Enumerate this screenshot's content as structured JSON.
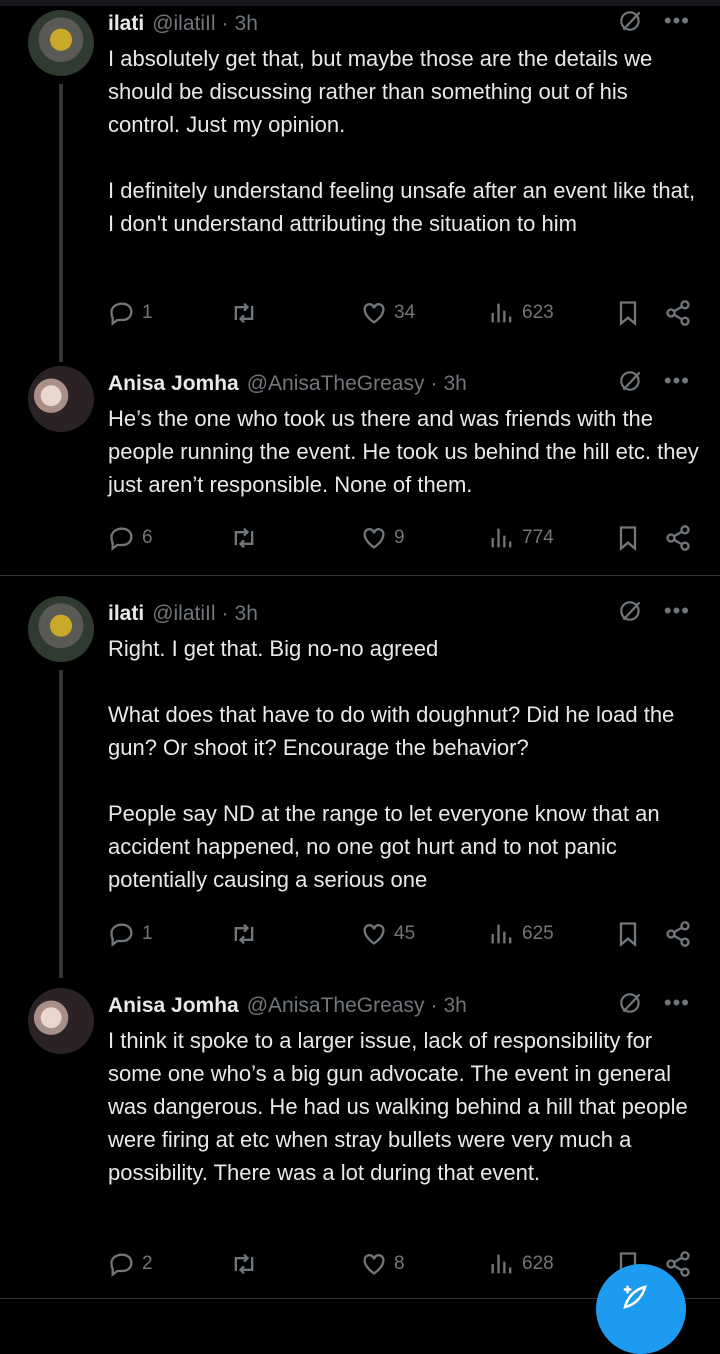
{
  "tweets": [
    {
      "name": "ilati",
      "handle": "@ilatiIl",
      "time": "3h",
      "avatar": "car-avatar",
      "paragraphs": [
        "I absolutely get that, but maybe those are the details we should be discussing rather than something out of his control. Just my opinion.",
        "I definitely understand feeling unsafe after an event like that, I don't understand attributing the situation to him"
      ],
      "replies": "1",
      "retweets": "",
      "likes": "34",
      "views": "623"
    },
    {
      "name": "Anisa Jomha",
      "handle": "@AnisaTheGreasy",
      "time": "3h",
      "avatar": "couple-avatar",
      "paragraphs": [
        "He’s the one who took us there and was friends with the people running the event. He took us behind the hill etc. they just aren’t responsible. None of them."
      ],
      "replies": "6",
      "retweets": "",
      "likes": "9",
      "views": "774"
    },
    {
      "name": "ilati",
      "handle": "@ilatiIl",
      "time": "3h",
      "avatar": "car-avatar",
      "paragraphs": [
        "Right. I get that. Big no-no agreed",
        "What does that have to do with doughnut? Did he load the gun? Or shoot it? Encourage the behavior?",
        "People say ND at the range to let everyone know that an accident happened, no one got hurt and to not panic potentially causing a serious one"
      ],
      "replies": "1",
      "retweets": "",
      "likes": "45",
      "views": "625"
    },
    {
      "name": "Anisa Jomha",
      "handle": "@AnisaTheGreasy",
      "time": "3h",
      "avatar": "couple-avatar",
      "paragraphs": [
        "I think it spoke to a larger issue, lack of responsibility for some one who’s a big gun advocate. The event in general was dangerous. He had us walking behind a hill that people were firing at etc when stray bullets were very much a possibility. There was a lot during that event."
      ],
      "replies": "2",
      "retweets": "",
      "likes": "8",
      "views": "628"
    }
  ],
  "icons": {
    "reply": "reply-icon",
    "retweet": "retweet-icon",
    "like": "heart-icon",
    "views": "views-icon",
    "bookmark": "bookmark-icon",
    "share": "share-icon",
    "grok": "grok-icon",
    "more": "more-icon",
    "compose": "compose-icon"
  },
  "colors": {
    "background": "#000000",
    "text": "#e7e9ea",
    "muted": "#71767b",
    "accent": "#1d9bf0",
    "divider": "#2f3336"
  }
}
